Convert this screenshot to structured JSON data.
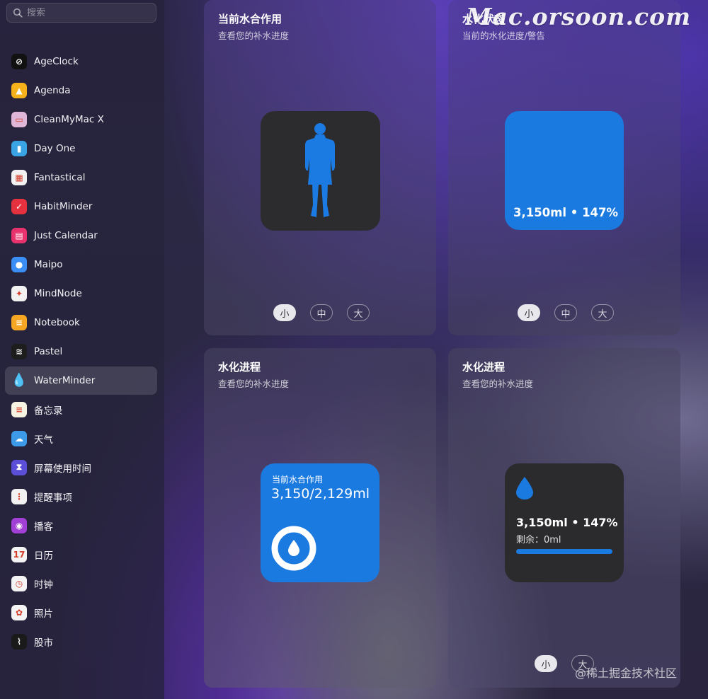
{
  "search": {
    "placeholder": "搜索"
  },
  "sidebar": {
    "items": [
      {
        "label": "AgeClock",
        "icon": "ageclock-icon",
        "color": "#111111",
        "glyph": "⊘"
      },
      {
        "label": "Agenda",
        "icon": "agenda-icon",
        "color": "#f6b21b",
        "glyph": "▲"
      },
      {
        "label": "CleanMyMac X",
        "icon": "cleanmymac-icon",
        "color": "#e0b6d8",
        "glyph": "▭"
      },
      {
        "label": "Day One",
        "icon": "dayone-icon",
        "color": "#3aa3e3",
        "glyph": "▮"
      },
      {
        "label": "Fantastical",
        "icon": "fantastical-icon",
        "color": "#f1f1f1",
        "glyph": "▦"
      },
      {
        "label": "HabitMinder",
        "icon": "habitminder-icon",
        "color": "#e6323f",
        "glyph": "✓"
      },
      {
        "label": "Just Calendar",
        "icon": "justcalendar-icon",
        "color": "#e8326e",
        "glyph": "▤"
      },
      {
        "label": "Maipo",
        "icon": "maipo-icon",
        "color": "#3b8ef5",
        "glyph": "●"
      },
      {
        "label": "MindNode",
        "icon": "mindnode-icon",
        "color": "#f2f2f2",
        "glyph": "✦"
      },
      {
        "label": "Notebook",
        "icon": "notebook-icon",
        "color": "#f5a623",
        "glyph": "≡"
      },
      {
        "label": "Pastel",
        "icon": "pastel-icon",
        "color": "#1d1d1d",
        "glyph": "≋"
      },
      {
        "label": "WaterMinder",
        "icon": "waterminder-icon",
        "color": "transparent",
        "glyph": "💧",
        "selected": true
      },
      {
        "label": "备忘录",
        "icon": "notes-icon",
        "color": "#f7f3e3",
        "glyph": "≡"
      },
      {
        "label": "天气",
        "icon": "weather-icon",
        "color": "#3c9ae8",
        "glyph": "☁"
      },
      {
        "label": "屏幕使用时间",
        "icon": "screentime-icon",
        "color": "#5b4fd8",
        "glyph": "⧗"
      },
      {
        "label": "提醒事项",
        "icon": "reminders-icon",
        "color": "#f2f2f2",
        "glyph": "⋮"
      },
      {
        "label": "播客",
        "icon": "podcasts-icon",
        "color": "#a13fd6",
        "glyph": "◉"
      },
      {
        "label": "日历",
        "icon": "calendar-icon",
        "color": "#f4f4f4",
        "glyph": "17"
      },
      {
        "label": "时钟",
        "icon": "clock-icon",
        "color": "#f4f4f4",
        "glyph": "◷"
      },
      {
        "label": "照片",
        "icon": "photos-icon",
        "color": "#f4f4f4",
        "glyph": "✿"
      },
      {
        "label": "股市",
        "icon": "stocks-icon",
        "color": "#1a1a1a",
        "glyph": "⌇"
      }
    ]
  },
  "cards": {
    "body": {
      "title": "当前水合作用",
      "subtitle": "查看您的补水进度",
      "sizes": [
        "小",
        "中",
        "大"
      ],
      "active_size": 0
    },
    "status": {
      "title": "水化状态",
      "subtitle": "当前的水化进度/警告",
      "value": "3,150ml • 147%",
      "sizes": [
        "小",
        "中",
        "大"
      ],
      "active_size": 0
    },
    "progress_ring": {
      "title": "水化进程",
      "subtitle": "查看您的补水进度",
      "widget_title": "当前水合作用",
      "widget_value": "3,150/2,129ml"
    },
    "progress_bar": {
      "title": "水化进程",
      "subtitle": "查看您的补水进度",
      "value": "3,150ml • 147%",
      "remaining": "剩余：0ml",
      "progress": 1.0,
      "sizes": [
        "小",
        "大"
      ],
      "active_size": 0
    }
  },
  "watermark": "Mac.orsoon.com",
  "credit": "@稀土掘金技术社区",
  "colors": {
    "accent": "#1a7ae0",
    "widget_dark": "#2b2b2d"
  }
}
